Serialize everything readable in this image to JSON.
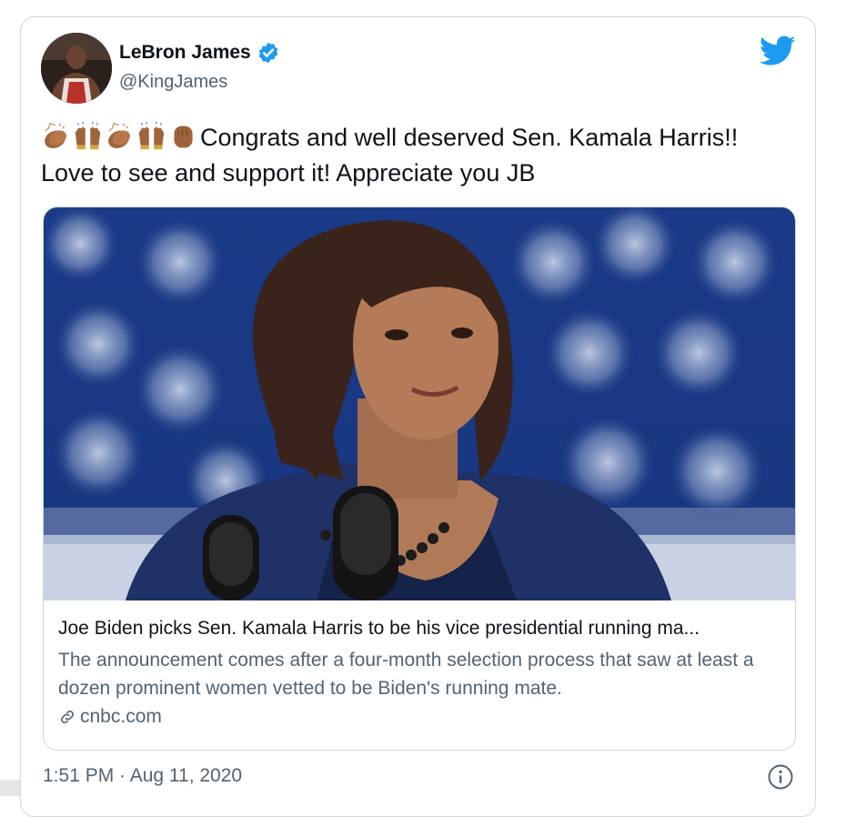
{
  "tweet": {
    "author": {
      "display_name": "LeBron James",
      "handle": "@KingJames",
      "verified": true,
      "avatar": "avatar-photo"
    },
    "emojis": [
      "clapping-hands-icon",
      "raising-hands-icon",
      "clapping-hands-icon",
      "raising-hands-icon",
      "raised-fist-icon"
    ],
    "text": "Congrats and well deserved Sen. Kamala Harris!! Love to see and support it! Appreciate you JB",
    "link_card": {
      "image": "kamala-harris-at-podium-photo",
      "title": "Joe Biden picks Sen. Kamala Harris to be his vice presidential running ma...",
      "description": "The announcement comes after a four-month selection process that saw at least a dozen prominent women vetted to be Biden's running mate.",
      "domain": "cnbc.com"
    },
    "timestamp": "1:51 PM · Aug 11, 2020"
  },
  "icons": {
    "brand": "twitter-bird-icon",
    "verified": "verified-badge-icon",
    "link": "link-icon",
    "info": "info-icon"
  },
  "colors": {
    "twitter_blue": "#1d9bf0",
    "text_primary": "#0f1419",
    "text_secondary": "#536471",
    "border": "#cfd9de",
    "emoji_skin": "#a0643c"
  }
}
